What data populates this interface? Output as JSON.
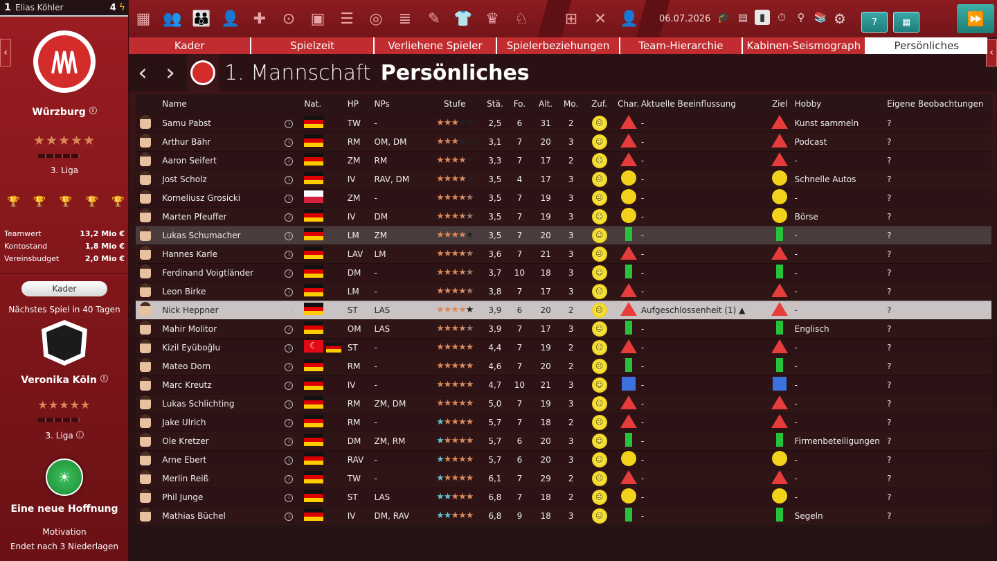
{
  "manager": {
    "rank": "1",
    "name": "Elias Köhler",
    "points": "4"
  },
  "club": {
    "name": "Würzburg",
    "stars": "★★★★★",
    "league": "3. Liga"
  },
  "finance": [
    {
      "label": "Teamwert",
      "value": "13,2 Mio €"
    },
    {
      "label": "Kontostand",
      "value": "1,8 Mio €"
    },
    {
      "label": "Vereinsbudget",
      "value": "2,0 Mio €"
    }
  ],
  "sidebar": {
    "kader_button": "Kader",
    "next_match": "Nächstes Spiel in 40 Tagen",
    "opponent": {
      "name": "Veronika Köln",
      "stars": "★★★★★",
      "league": "3. Liga"
    },
    "motivation": {
      "title": "Eine neue Hoffnung",
      "label": "Motivation",
      "ends": "Endet nach 3 Niederlagen"
    }
  },
  "toolbar": {
    "date": "06.07.2026",
    "calendar_day": "7"
  },
  "tabs": [
    "Kader",
    "Spielzeit",
    "Verliehene Spieler",
    "Spielerbeziehungen",
    "Team-Hierarchie",
    "Kabinen-Seismograph",
    "Persönliches"
  ],
  "heading": {
    "team": "1. Mannschaft",
    "page": "Persönliches"
  },
  "columns": {
    "name": "Name",
    "nat": "Nat.",
    "hp": "HP",
    "nps": "NPs",
    "stufe": "Stufe",
    "sta": "Stä.",
    "fo": "Fo.",
    "alt": "Alt.",
    "mo": "Mo.",
    "zuf": "Zuf.",
    "char": "Char.",
    "infl": "Aktuelle Beeinflussung",
    "ziel": "Ziel",
    "hobby": "Hobby",
    "obs": "Eigene Beobachtungen"
  },
  "players": [
    {
      "name": "Samu Pabst",
      "nat": "de",
      "hp": "TW",
      "nps": "-",
      "stars": "ooo ee",
      "sta": "2,5",
      "fo": "6",
      "alt": "31",
      "mo": "2",
      "mood": "neutral",
      "char": "tri",
      "infl": "-",
      "ziel": "tri",
      "hobby": "Kunst sammeln",
      "obs": "?"
    },
    {
      "name": "Arthur Bähr",
      "nat": "de",
      "hp": "RM",
      "nps": "OM, DM",
      "stars": "ooo ee",
      "sta": "3,1",
      "fo": "7",
      "alt": "20",
      "mo": "3",
      "mood": "happy",
      "char": "tri",
      "infl": "-",
      "ziel": "tri",
      "hobby": "Podcast",
      "obs": "?"
    },
    {
      "name": "Aaron Seifert",
      "nat": "de",
      "hp": "ZM",
      "nps": "RM",
      "stars": "oooo e",
      "sta": "3,3",
      "fo": "7",
      "alt": "17",
      "mo": "2",
      "mood": "sad",
      "char": "tri",
      "infl": "-",
      "ziel": "tri",
      "hobby": "-",
      "obs": "?"
    },
    {
      "name": "Jost Scholz",
      "nat": "de",
      "hp": "IV",
      "nps": "RAV, DM",
      "stars": "oooo e",
      "sta": "3,5",
      "fo": "4",
      "alt": "17",
      "mo": "3",
      "mood": "neutral",
      "char": "circ",
      "infl": "-",
      "ziel": "circ",
      "hobby": "Schnelle Autos",
      "obs": "?"
    },
    {
      "name": "Korneliusz Grosicki",
      "nat": "pl",
      "hp": "ZM",
      "nps": "-",
      "stars": "oooo h",
      "sta": "3,5",
      "fo": "7",
      "alt": "19",
      "mo": "3",
      "mood": "neutral",
      "char": "circ",
      "infl": "-",
      "ziel": "circ",
      "hobby": "-",
      "obs": "?"
    },
    {
      "name": "Marten Pfeuffer",
      "nat": "de",
      "hp": "IV",
      "nps": "DM",
      "stars": "oooo h",
      "sta": "3,5",
      "fo": "7",
      "alt": "19",
      "mo": "3",
      "mood": "neutral",
      "char": "circ",
      "infl": "-",
      "ziel": "circ",
      "hobby": "Börse",
      "obs": "?"
    },
    {
      "name": "Lukas Schumacher",
      "nat": "de",
      "hp": "LM",
      "nps": "ZM",
      "stars": "oooo e",
      "sta": "3,5",
      "fo": "7",
      "alt": "20",
      "mo": "3",
      "mood": "happy",
      "char": "rect",
      "infl": "-",
      "ziel": "rect",
      "hobby": "-",
      "obs": "?"
    },
    {
      "name": "Hannes Karle",
      "nat": "de",
      "hp": "LAV",
      "nps": "LM",
      "stars": "oooo h",
      "sta": "3,6",
      "fo": "7",
      "alt": "21",
      "mo": "3",
      "mood": "neutral",
      "char": "tri",
      "infl": "-",
      "ziel": "tri",
      "hobby": "-",
      "obs": "?"
    },
    {
      "name": "Ferdinand Voigtländer",
      "nat": "de",
      "hp": "DM",
      "nps": "-",
      "stars": "oooo h",
      "sta": "3,7",
      "fo": "10",
      "alt": "18",
      "mo": "3",
      "mood": "happy",
      "char": "rect",
      "infl": "-",
      "ziel": "rect",
      "hobby": "-",
      "obs": "?"
    },
    {
      "name": "Leon Birke",
      "nat": "de",
      "hp": "LM",
      "nps": "-",
      "stars": "oooo h",
      "sta": "3,8",
      "fo": "7",
      "alt": "17",
      "mo": "3",
      "mood": "neutral",
      "char": "tri",
      "infl": "-",
      "ziel": "tri",
      "hobby": "-",
      "obs": "?"
    },
    {
      "name": "Nick Heppner",
      "nat": "de",
      "hp": "ST",
      "nps": "LAS",
      "stars": "oooo e",
      "sta": "3,9",
      "fo": "6",
      "alt": "20",
      "mo": "2",
      "mood": "sad",
      "char": "tri",
      "infl": "Aufgeschlossenheit (1) ▲",
      "ziel": "tri",
      "hobby": "-",
      "obs": "?"
    },
    {
      "name": "Mahir Molitor",
      "nat": "de",
      "hp": "OM",
      "nps": "LAS",
      "stars": "oooo h",
      "sta": "3,9",
      "fo": "7",
      "alt": "17",
      "mo": "3",
      "mood": "neutral",
      "char": "rect",
      "infl": "-",
      "ziel": "rect",
      "hobby": "Englisch",
      "obs": "?"
    },
    {
      "name": "Kizil Eyüboğlu",
      "nat": "tr",
      "hp": "ST",
      "nps": "-",
      "stars": "ooooo",
      "sta": "4,4",
      "fo": "7",
      "alt": "19",
      "mo": "2",
      "mood": "sad",
      "char": "tri",
      "infl": "-",
      "ziel": "tri",
      "hobby": "-",
      "obs": "?"
    },
    {
      "name": "Mateo Dorn",
      "nat": "de",
      "hp": "RM",
      "nps": "-",
      "stars": "ooooo",
      "sta": "4,6",
      "fo": "7",
      "alt": "20",
      "mo": "2",
      "mood": "sad",
      "char": "rect",
      "infl": "-",
      "ziel": "rect",
      "hobby": "-",
      "obs": "?"
    },
    {
      "name": "Marc Kreutz",
      "nat": "de",
      "hp": "IV",
      "nps": "-",
      "stars": "ooooo",
      "sta": "4,7",
      "fo": "10",
      "alt": "21",
      "mo": "3",
      "mood": "happy",
      "char": "sq",
      "infl": "-",
      "ziel": "sq",
      "hobby": "-",
      "obs": "?"
    },
    {
      "name": "Lukas Schlichting",
      "nat": "de",
      "hp": "RM",
      "nps": "ZM, DM",
      "stars": "ooooo",
      "sta": "5,0",
      "fo": "7",
      "alt": "19",
      "mo": "3",
      "mood": "neutral",
      "char": "tri",
      "infl": "-",
      "ziel": "tri",
      "hobby": "-",
      "obs": "?"
    },
    {
      "name": "Jake Ulrich",
      "nat": "de",
      "hp": "RM",
      "nps": "-",
      "stars": "boooo",
      "sta": "5,7",
      "fo": "7",
      "alt": "18",
      "mo": "2",
      "mood": "sad",
      "char": "tri",
      "infl": "-",
      "ziel": "tri",
      "hobby": "-",
      "obs": "?"
    },
    {
      "name": "Ole Kretzer",
      "nat": "de",
      "hp": "DM",
      "nps": "ZM, RM",
      "stars": "boooo",
      "sta": "5,7",
      "fo": "6",
      "alt": "20",
      "mo": "3",
      "mood": "happy",
      "char": "rect",
      "infl": "-",
      "ziel": "rect",
      "hobby": "Firmenbeteiligungen",
      "obs": "?"
    },
    {
      "name": "Arne Ebert",
      "nat": "de",
      "hp": "RAV",
      "nps": "-",
      "stars": "boooo",
      "sta": "5,7",
      "fo": "6",
      "alt": "20",
      "mo": "3",
      "mood": "happy",
      "char": "circ",
      "infl": "-",
      "ziel": "circ",
      "hobby": "-",
      "obs": "?"
    },
    {
      "name": "Merlin Reiß",
      "nat": "de",
      "hp": "TW",
      "nps": "-",
      "stars": "boooo",
      "sta": "6,1",
      "fo": "7",
      "alt": "29",
      "mo": "2",
      "mood": "sad",
      "char": "tri",
      "infl": "-",
      "ziel": "tri",
      "hobby": "-",
      "obs": "?"
    },
    {
      "name": "Phil Junge",
      "nat": "de",
      "hp": "ST",
      "nps": "LAS",
      "stars": "bbooo",
      "sta": "6,8",
      "fo": "7",
      "alt": "18",
      "mo": "2",
      "mood": "neutral",
      "char": "circ",
      "infl": "-",
      "ziel": "circ",
      "hobby": "-",
      "obs": "?"
    },
    {
      "name": "Mathias Büchel",
      "nat": "de",
      "hp": "IV",
      "nps": "DM, RAV",
      "stars": "bbooo",
      "sta": "6,8",
      "fo": "9",
      "alt": "18",
      "mo": "3",
      "mood": "neutral",
      "char": "rect",
      "infl": "-",
      "ziel": "rect",
      "hobby": "Segeln",
      "obs": "?"
    }
  ]
}
